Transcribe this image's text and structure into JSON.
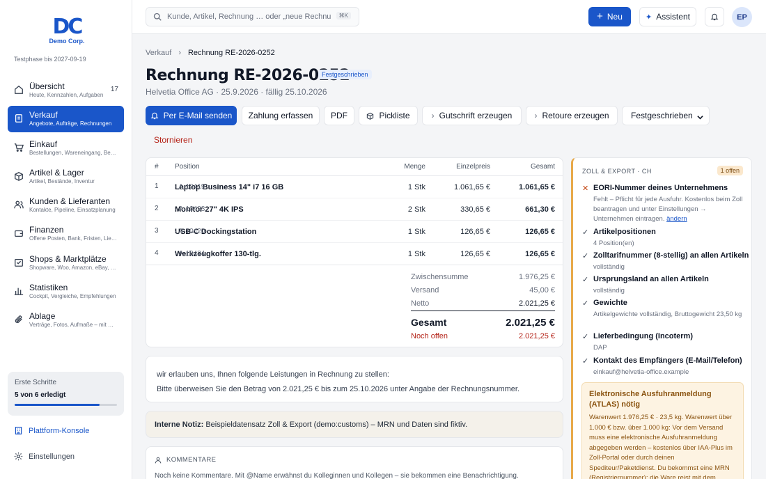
{
  "brand": {
    "logo_mark": "DC",
    "name": "Demo Corp.",
    "trial": "Testphase bis 2027-09-19"
  },
  "sidebar": {
    "items": [
      {
        "label": "Übersicht",
        "sub": "Heute, Kennzahlen, Aufgaben",
        "badge": "17",
        "icon": "home-icon"
      },
      {
        "label": "Verkauf",
        "sub": "Angebote, Aufträge, Rechnungen",
        "icon": "receipt-icon",
        "active": true
      },
      {
        "label": "Einkauf",
        "sub": "Bestellungen, Wareneingang, Belege",
        "icon": "cart-icon"
      },
      {
        "label": "Artikel & Lager",
        "sub": "Artikel, Bestände, Inventur",
        "icon": "box-icon"
      },
      {
        "label": "Kunden & Lieferanten",
        "sub": "Kontakte, Pipeline, Einsatzplanung",
        "icon": "users-icon"
      },
      {
        "label": "Finanzen",
        "sub": "Offene Posten, Bank, Fristen, Lieferanten",
        "icon": "wallet-icon"
      },
      {
        "label": "Shops & Marktplätze",
        "sub": "Shopware, Woo, Amazon, eBay, Etsy",
        "icon": "store-icon"
      },
      {
        "label": "Statistiken",
        "sub": "Cockpit, Vergleiche, Empfehlungen",
        "icon": "chart-icon"
      },
      {
        "label": "Ablage",
        "sub": "Verträge, Fotos, Aufmaße – mit Suche",
        "icon": "paperclip-icon"
      }
    ],
    "steps": {
      "title": "Erste Schritte",
      "progress_text": "5 von 6 erledigt",
      "progress": 0.83
    },
    "platform": "Plattform-Konsole",
    "settings": "Einstellungen"
  },
  "topbar": {
    "search_placeholder": "Kunde, Artikel, Rechnung … oder „neue Rechnung“",
    "search_kbd": "⌘K",
    "new_label": "Neu",
    "assistant_label": "Assistent",
    "avatar": "EP"
  },
  "breadcrumb": {
    "parent": "Verkauf",
    "current": "Rechnung RE-2026-0252"
  },
  "invoice": {
    "title": "Rechnung RE-2026-0252",
    "status": "Festgeschrieben",
    "subtitle": "Helvetia Office AG · 25.9.2026 · fällig 25.10.2026"
  },
  "actions": {
    "email": "Per E-Mail senden",
    "payment": "Zahlung erfassen",
    "pdf": "PDF",
    "picklist": "Pickliste",
    "credit": "Gutschrift erzeugen",
    "return": "Retoure erzeugen",
    "status_select": "Festgeschrieben",
    "cancel": "Stornieren"
  },
  "table": {
    "headers": {
      "num": "#",
      "pos": "Position",
      "qty": "Menge",
      "unit": "Einzelpreis",
      "total": "Gesamt"
    },
    "rows": [
      {
        "num": "1",
        "name": "Laptop Business 14\" i7 16 GB",
        "sku": " · A-10419",
        "qty": "1 Stk",
        "unit": "1.061,65 €",
        "total": "1.061,65 €"
      },
      {
        "num": "2",
        "name": "Monitor 27\" 4K IPS",
        "sku": " · A-10423",
        "qty": "2 Stk",
        "unit": "330,65 €",
        "total": "661,30 €"
      },
      {
        "num": "3",
        "name": "USB-C Dockingstation",
        "sku": " · A-10420",
        "qty": "1 Stk",
        "unit": "126,65 €",
        "total": "126,65 €"
      },
      {
        "num": "4",
        "name": "Werkzeugkoffer 130-tlg.",
        "sku": " · A-10434",
        "qty": "1 Stk",
        "unit": "126,65 €",
        "total": "126,65 €"
      }
    ]
  },
  "totals": {
    "subtotal_label": "Zwischensumme",
    "subtotal": "1.976,25 €",
    "shipping_label": "Versand",
    "shipping": "45,00 €",
    "net_label": "Netto",
    "net": "2.021,25 €",
    "total_label": "Gesamt",
    "total": "2.021,25 €",
    "open_label": "Noch offen",
    "open": "2.021,25 €"
  },
  "text": {
    "line1": "wir erlauben uns, Ihnen folgende Leistungen in Rechnung zu stellen:",
    "line2": "Bitte überweisen Sie den Betrag von 2.021,25 € bis zum 25.10.2026 unter Angabe der Rechnungsnummer."
  },
  "note": {
    "label": "Interne Notiz:",
    "text": " Beispieldatensatz Zoll & Export (demo:customs) – MRN und Daten sind fiktiv."
  },
  "comments": {
    "title": "KOMMENTARE",
    "empty": "Noch keine Kommentare. Mit @Name erwähnst du Kolleginnen und Kollegen – sie bekommen eine Benachrichtigung."
  },
  "customs": {
    "title": "ZOLL & EXPORT · CH",
    "pill": "1 offen",
    "checks": [
      {
        "ok": false,
        "title": "EORI-Nummer deines Unternehmens",
        "desc": "Fehlt – Pflicht für jede Ausfuhr. Kostenlos beim Zoll beantragen und unter Einstellungen → Unternehmen eintragen.",
        "link": "ändern"
      },
      {
        "ok": true,
        "title": "Artikelpositionen",
        "desc": "4 Position(en)"
      },
      {
        "ok": true,
        "title": "Zolltarifnummer (8-stellig) an allen Artikeln",
        "desc": "vollständig"
      },
      {
        "ok": true,
        "title": "Ursprungsland an allen Artikeln",
        "desc": "vollständig"
      },
      {
        "ok": true,
        "title": "Gewichte",
        "desc": "Artikelgewichte vollständig, Bruttogewicht 23,50 kg"
      },
      {
        "ok": true,
        "title": "Lieferbedingung (Incoterm)",
        "desc": "DAP"
      },
      {
        "ok": true,
        "title": "Kontakt des Empfängers (E-Mail/Telefon)",
        "desc": "einkauf@helvetia-office.example"
      }
    ],
    "atlas_title": "Elektronische Ausfuhranmeldung (ATLAS) nötig",
    "atlas_text": "Warenwert 1.976,25 € · 23,5 kg. Warenwert über 1.000 € bzw. über 1.000 kg: Vor dem Versand muss eine elektronische Ausfuhranmeldung abgegeben werden – kostenlos über IAA-Plus im Zoll-Portal oder durch deinen Spediteur/Paketdienst. Du bekommst eine MRN (Registriernummer); die Ware reist mit dem"
  },
  "colors": {
    "accent": "#1a56c9",
    "danger": "#b42318",
    "warning_bg": "#fdf3e2"
  }
}
